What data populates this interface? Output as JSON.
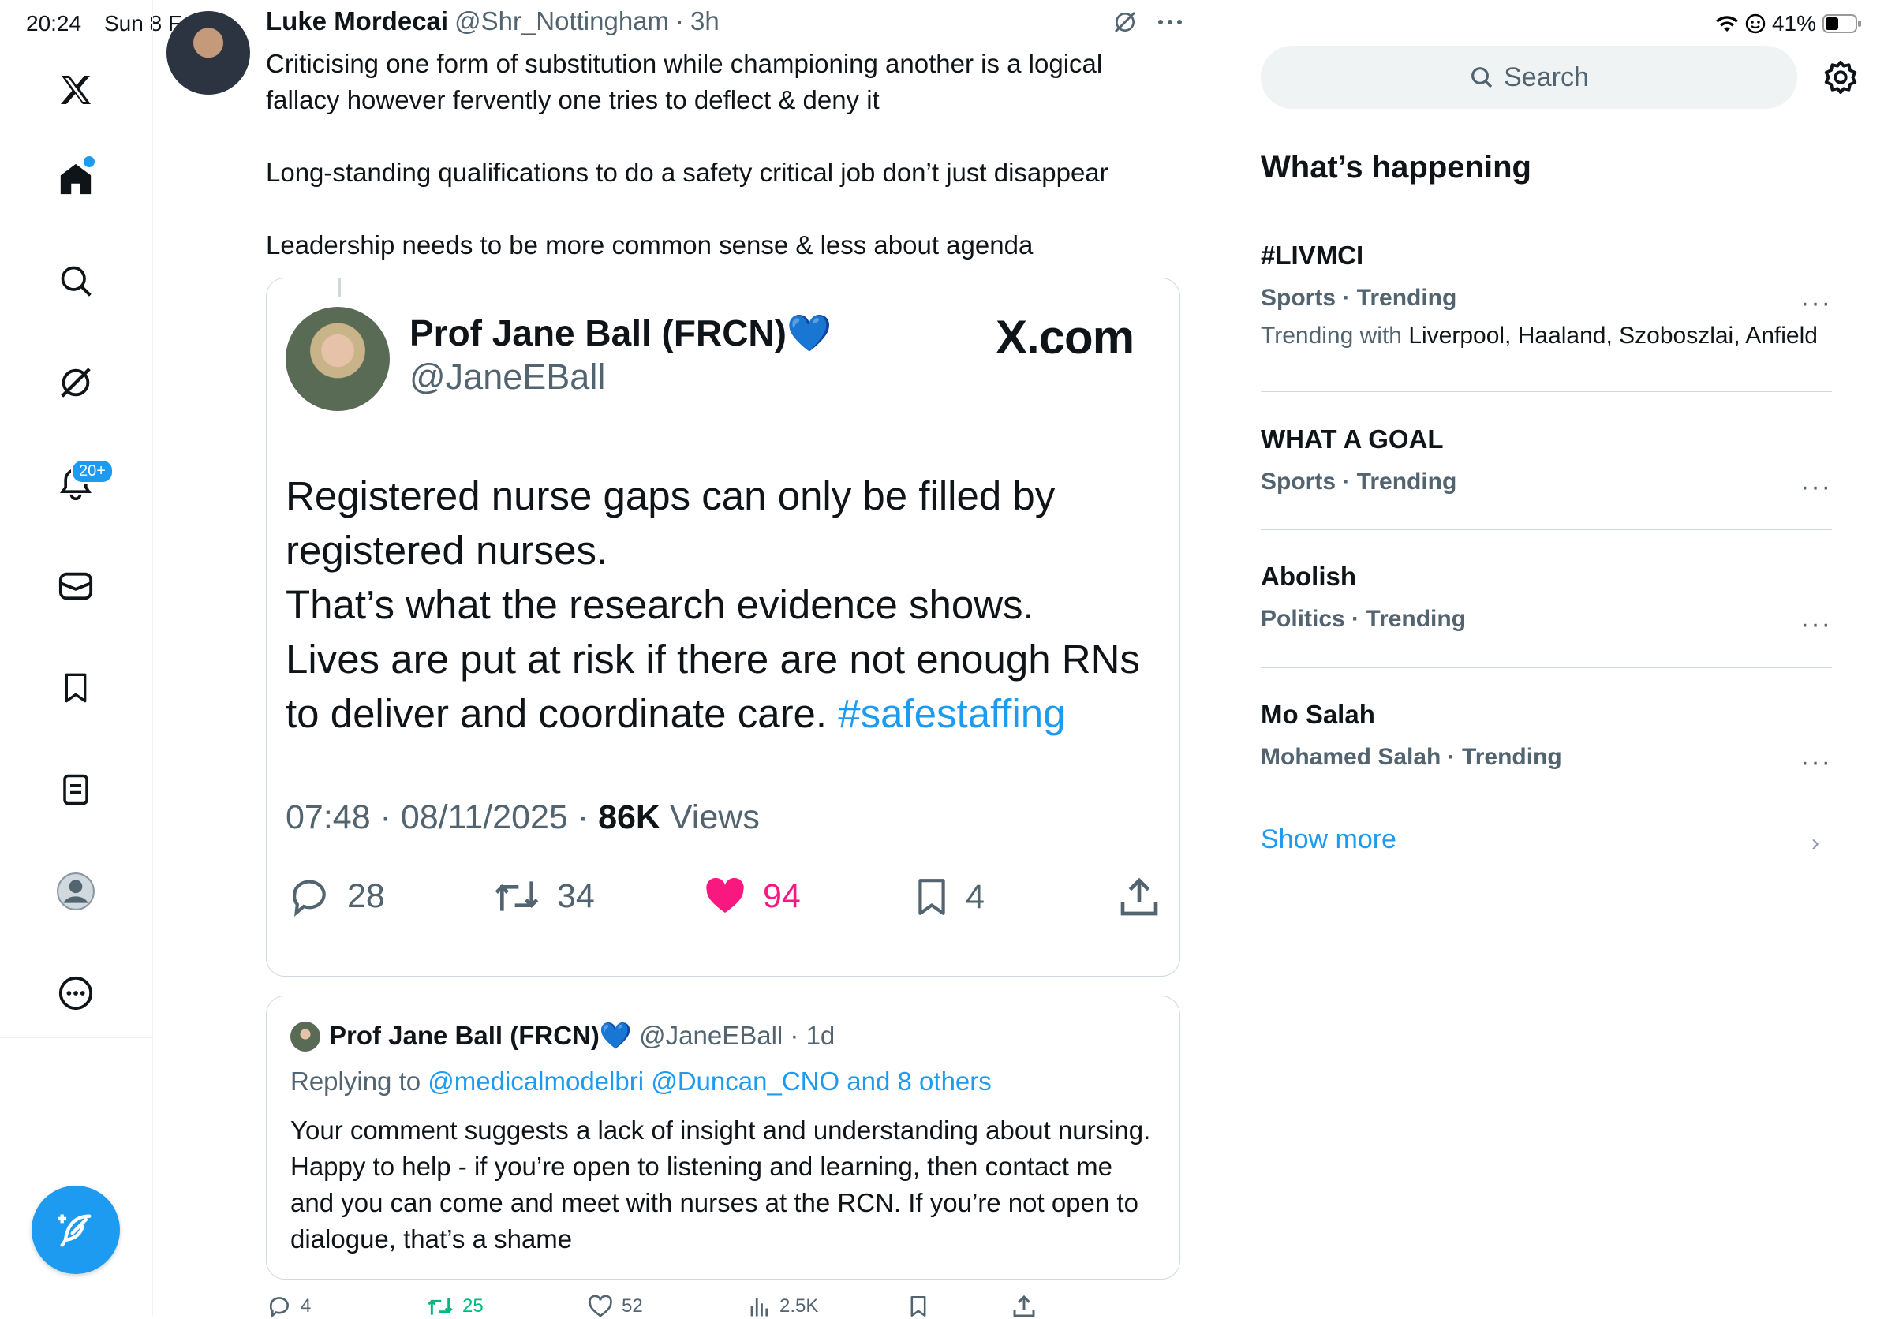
{
  "status_bar": {
    "time": "20:24",
    "date": "Sun 8 Feb",
    "battery": "41%"
  },
  "nav": {
    "logo": "x-logo-icon",
    "items": [
      "home-icon",
      "search-icon",
      "grok-icon",
      "notifications-icon",
      "messages-icon",
      "bookmarks-icon",
      "lists-icon",
      "profile-icon",
      "more-icon"
    ],
    "notifications_badge": "20+"
  },
  "post": {
    "author_name": "Luke Mordecai",
    "author_handle": "@Shr_Nottingham",
    "time": "3h",
    "paragraphs": [
      "Criticising one form of substitution while championing another is a logical fallacy however fervently one tries to deflect & deny it",
      "Long-standing qualifications to do a safety critical job don’t just disappear",
      "Leadership needs to be more common sense & less about agenda"
    ]
  },
  "quote_card": {
    "name": "Prof Jane Ball (FRCN)💙",
    "handle": "@JaneEBall",
    "source": "X.com",
    "text_main": "Registered nurse gaps can only be filled by registered nurses.\nThat’s what the research evidence shows.\nLives are put at risk if there are not enough RNs to deliver and coordinate care. ",
    "hashtag": "#safestaffing",
    "timestamp": "07:48 · 08/11/2025 · ",
    "views_count": "86K",
    "views_label": "Views",
    "replies": "28",
    "reposts": "34",
    "likes": "94",
    "bookmarks": "4",
    "accent_like": "#f91880"
  },
  "reply": {
    "name": "Prof Jane Ball (FRCN)💙",
    "handle_time": "@JaneEBall · 1d",
    "replying_label": "Replying to ",
    "replying_targets": "@medicalmodelbri @Duncan_CNO and 8 others",
    "text": "Your comment suggests a lack of insight and understanding about nursing. Happy to help - if you’re open to listening and learning, then contact me and you can come and meet with nurses at the RCN. If you’re not open to dialogue, that’s a shame"
  },
  "post_actions": {
    "replies": "4",
    "reposts": "25",
    "likes": "52",
    "views": "2.5K"
  },
  "sidebar": {
    "search_placeholder": "Search",
    "heading": "What’s happening",
    "trends": [
      {
        "title": "#LIVMCI",
        "category": "Sports · Trending",
        "with_label": "Trending with ",
        "with": "Liverpool, Haaland, Szoboszlai, Anfield"
      },
      {
        "title": "WHAT A GOAL",
        "category": "Sports · Trending"
      },
      {
        "title": "Abolish",
        "category": "Politics · Trending"
      },
      {
        "title": "Mo Salah",
        "category": "Mohamed Salah · Trending"
      }
    ],
    "more_label": "···",
    "show_more": "Show more"
  },
  "colors": {
    "accent": "#1d9bf0",
    "text": "#0f1419",
    "muted": "#536471"
  }
}
